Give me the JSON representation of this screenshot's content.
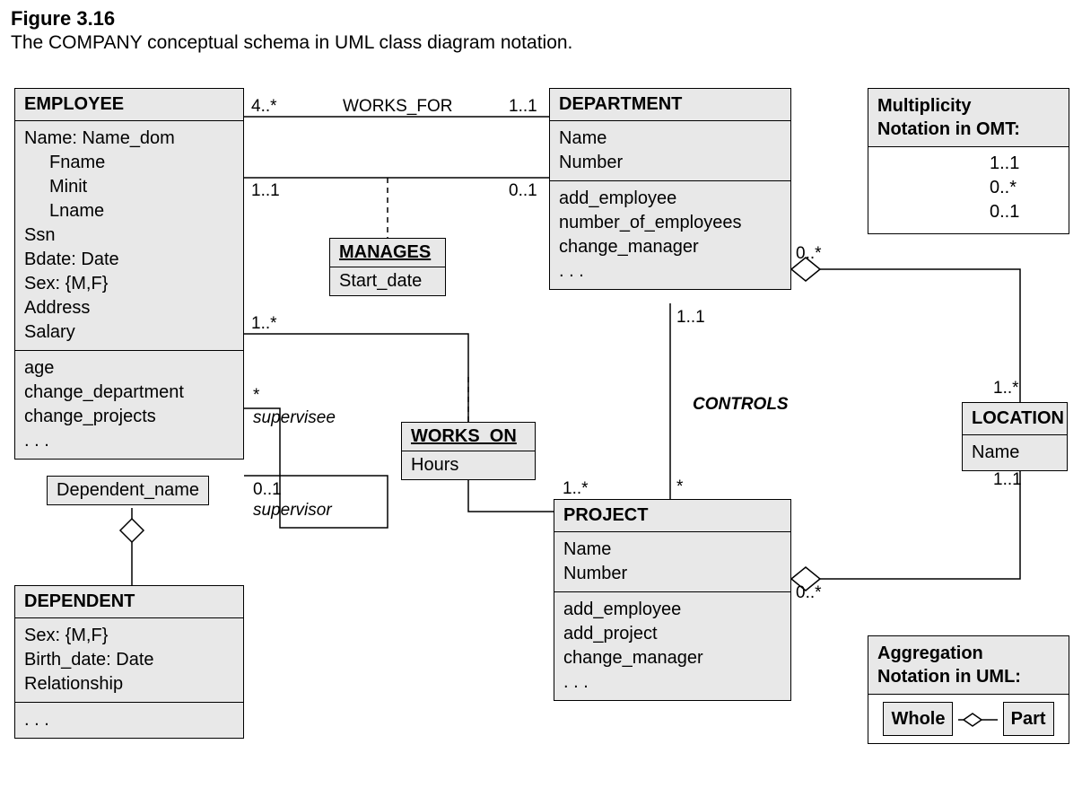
{
  "figure": {
    "number": "Figure 3.16",
    "caption": "The COMPANY conceptual schema in UML class diagram notation."
  },
  "classes": {
    "employee": {
      "title": "EMPLOYEE",
      "attrs": {
        "a1": "Name: Name_dom",
        "a1a": "Fname",
        "a1b": "Minit",
        "a1c": "Lname",
        "a2": "Ssn",
        "a3": "Bdate: Date",
        "a4": "Sex: {M,F}",
        "a5": "Address",
        "a6": "Salary"
      },
      "ops": {
        "o1": "age",
        "o2": "change_department",
        "o3": "change_projects",
        "o4": ". . ."
      }
    },
    "department": {
      "title": "DEPARTMENT",
      "attrs": {
        "a1": "Name",
        "a2": "Number"
      },
      "ops": {
        "o1": "add_employee",
        "o2": "number_of_employees",
        "o3": "change_manager",
        "o4": ". . ."
      }
    },
    "project": {
      "title": "PROJECT",
      "attrs": {
        "a1": "Name",
        "a2": "Number"
      },
      "ops": {
        "o1": "add_employee",
        "o2": "add_project",
        "o3": "change_manager",
        "o4": ". . ."
      }
    },
    "dependent": {
      "title": "DEPENDENT",
      "attrs": {
        "a1": "Sex: {M,F}",
        "a2": "Birth_date: Date",
        "a3": "Relationship"
      },
      "ops": {
        "o1": ". . ."
      }
    },
    "location": {
      "title": "LOCATION",
      "attr": "Name"
    }
  },
  "assocs": {
    "manages": {
      "title": "MANAGES",
      "attr": "Start_date"
    },
    "works_on": {
      "title": "WORKS_ON",
      "attr": "Hours"
    }
  },
  "qualifiers": {
    "depname": "Dependent_name"
  },
  "labels": {
    "works_for": "WORKS_FOR",
    "wf_left": "4..*",
    "wf_right": "1..1",
    "mg_left": "1..1",
    "mg_right": "0..1",
    "workson_top": "1..*",
    "workson_bot": "1..*",
    "supervisee": "supervisee",
    "supervisor": "supervisor",
    "sup_top": "*",
    "sup_bot": "0..1",
    "controls": "CONTROLS",
    "ctrl_top": "1..1",
    "ctrl_bot": "*",
    "deptloc_top": "0..*",
    "deptloc_bot": "1..*",
    "projloc_top": "1..1",
    "projloc_bot": "0..*"
  },
  "legend1": {
    "title1": "Multiplicity",
    "title2": "Notation in OMT:",
    "r1": "1..1",
    "r2": "0..*",
    "r3": "0..1"
  },
  "legend2": {
    "title1": "Aggregation",
    "title2": "Notation in UML:",
    "whole": "Whole",
    "part": "Part"
  }
}
